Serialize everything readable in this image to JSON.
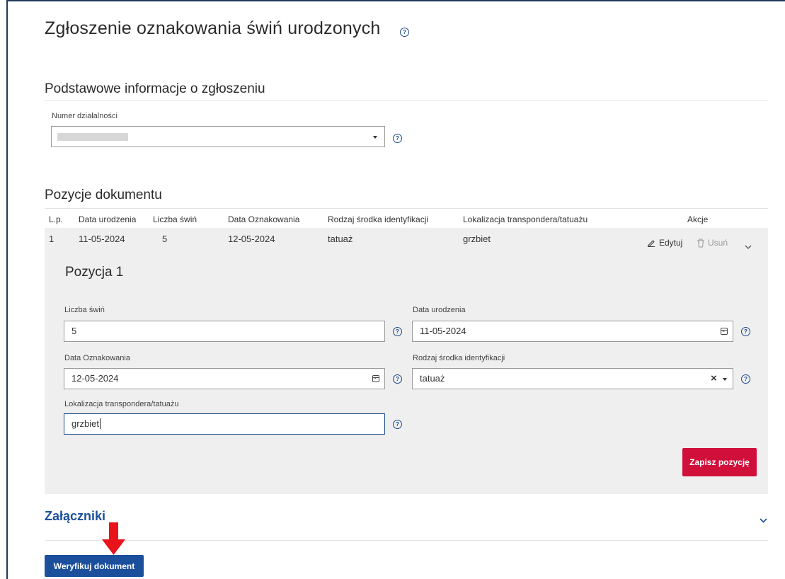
{
  "page": {
    "title": "Zgłoszenie oznakowania świń urodzonych"
  },
  "basic_info": {
    "title": "Podstawowe informacje o zgłoszeniu",
    "activity_number_label": "Numer działalności",
    "activity_number_value": ""
  },
  "items": {
    "title": "Pozycje dokumentu",
    "columns": [
      "L.p.",
      "Data urodzenia",
      "Liczba świń",
      "Data Oznakowania",
      "Rodzaj środka identyfikacji",
      "Lokalizacja transpondera/tatuażu",
      "Akcje"
    ],
    "rows": [
      {
        "lp": "1",
        "birth_date": "11-05-2024",
        "pig_count": "5",
        "marking_date": "12-05-2024",
        "id_type": "tatuaż",
        "location": "grzbiet",
        "edit_label": "Edytuj",
        "delete_label": "Usuń"
      }
    ]
  },
  "position_form": {
    "title": "Pozycja 1",
    "pig_count_label": "Liczba świń",
    "pig_count_value": "5",
    "birth_date_label": "Data urodzenia",
    "birth_date_value": "11-05-2024",
    "marking_date_label": "Data Oznakowania",
    "marking_date_value": "12-05-2024",
    "id_type_label": "Rodzaj środka identyfikacji",
    "id_type_value": "tatuaż",
    "location_label": "Lokalizacja transpondera/tatuażu",
    "location_value": "grzbiet",
    "save_label": "Zapisz pozycję"
  },
  "attachments": {
    "title": "Załączniki"
  },
  "footer": {
    "verify_label": "Weryfikuj dokument"
  },
  "colors": {
    "primary_blue": "#1b4f9c",
    "danger_red": "#d0103a",
    "panel_grey": "#efefef",
    "annotation_arrow": "#e8131b"
  }
}
